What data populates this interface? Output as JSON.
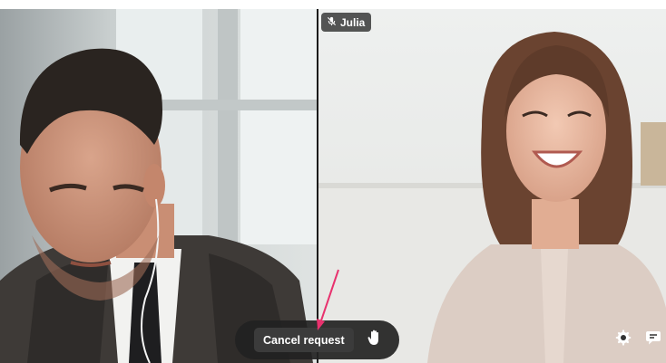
{
  "participants": [
    {
      "name": ""
    },
    {
      "name": "Julia",
      "mic_status_icon": "mic-off-icon"
    }
  ],
  "controls": {
    "cancel_request_label": "Cancel request",
    "raise_hand_icon": "hand-icon",
    "settings_icon": "gear-icon",
    "chat_icon": "chat-icon"
  },
  "annotation": {
    "arrow_color": "#e8326e"
  },
  "colors": {
    "control_bar": "#222222",
    "button_bg": "#3b3b3b",
    "badge_bg": "#282828"
  }
}
